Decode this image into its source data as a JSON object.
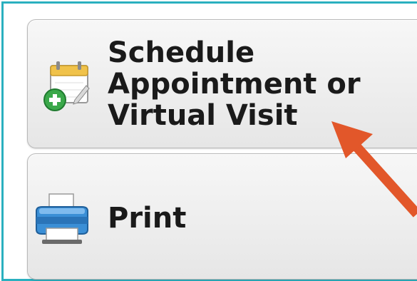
{
  "buttons": {
    "schedule": {
      "label": "Schedule Appointment or Virtual Visit",
      "icon": "calendar-add-icon"
    },
    "print": {
      "label": "Print",
      "icon": "printer-icon"
    }
  },
  "colors": {
    "frame": "#2ab0bf",
    "arrow": "#e2572a",
    "button_bg": "#eeeeee",
    "text": "#1a1a1a"
  }
}
